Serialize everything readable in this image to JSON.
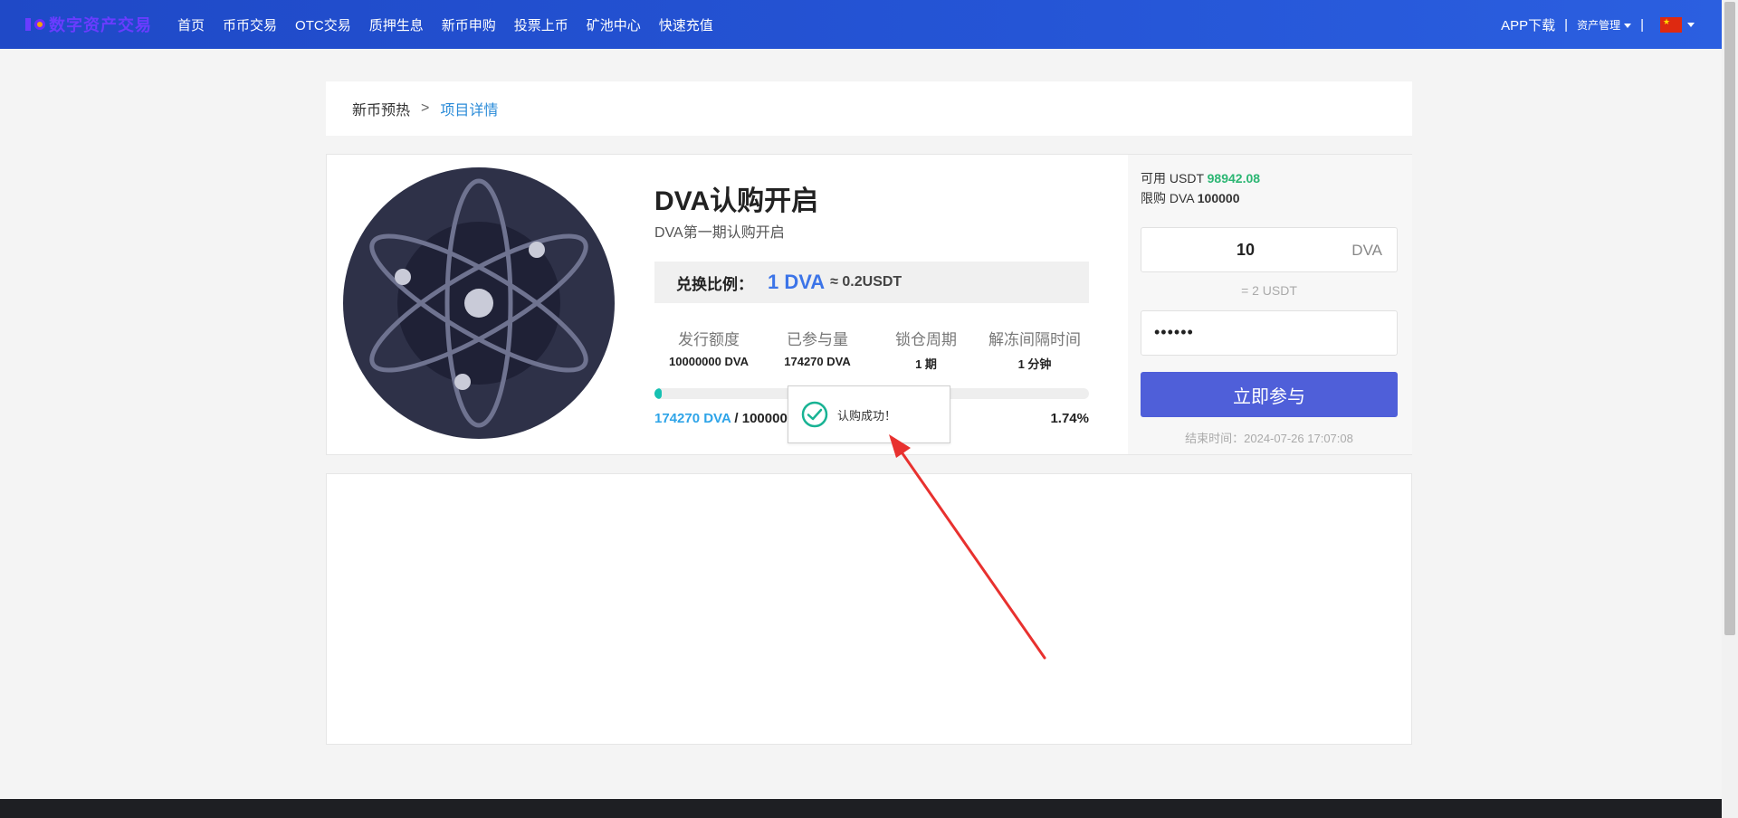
{
  "header": {
    "logo_text": "数字资产交易",
    "nav": [
      "首页",
      "币币交易",
      "OTC交易",
      "质押生息",
      "新币申购",
      "投票上币",
      "矿池中心",
      "快速充值"
    ],
    "app_download": "APP下载",
    "sep": "|",
    "asset_manage": "资产管理"
  },
  "breadcrumb": {
    "parent": "新币预热",
    "sep": ">",
    "current": "项目详情"
  },
  "project": {
    "title": "DVA认购开启",
    "subtitle": "DVA第一期认购开启",
    "ratio_label": "兑换比例：",
    "ratio_value": "1 DVA",
    "ratio_approx": "≈ 0.2USDT",
    "stats": [
      {
        "label": "发行额度",
        "value": "10000000 DVA"
      },
      {
        "label": "已参与量",
        "value": "174270 DVA"
      },
      {
        "label": "锁仓周期",
        "value": "1 期"
      },
      {
        "label": "解冻间隔时间",
        "value": "1 分钟"
      }
    ],
    "progress": {
      "sold": "174270 DVA",
      "sep": " / ",
      "total": "10000000 DVA",
      "percent": "1.74%",
      "fraction": 0.0174
    }
  },
  "side": {
    "available_label": "可用 USDT",
    "available_value": "98942.08",
    "limit_label": "限购 DVA",
    "limit_value": "100000",
    "amount_value": "10",
    "amount_unit": "DVA",
    "equiv": "= 2 USDT",
    "password_mask": "••••••",
    "join_button": "立即参与",
    "end_time": "结束时间：2024-07-26 17:07:08"
  },
  "toast": {
    "message": "认购成功！"
  },
  "colors": {
    "header": "#2555d6",
    "accent_blue": "#2ea4e8",
    "green": "#2bb673",
    "button": "#4f5fd9",
    "progress": "#16c1b2",
    "arrow": "#e8312f"
  }
}
